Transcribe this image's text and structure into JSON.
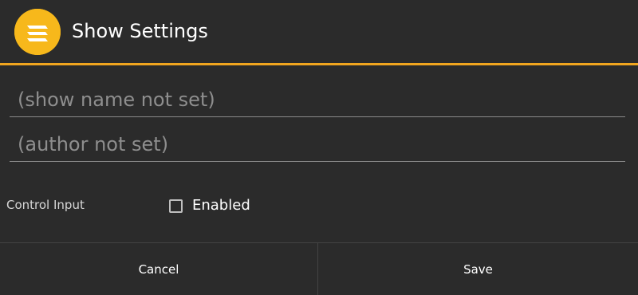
{
  "dialog": {
    "title": "Show Settings",
    "icon": "stacked-lines-logo-icon"
  },
  "fields": {
    "show_name_placeholder": "(show name not set)",
    "author_placeholder": "(author not set)"
  },
  "control_input": {
    "label": "Control Input",
    "checkbox_label": "Enabled",
    "checked": false
  },
  "buttons": {
    "cancel": "Cancel",
    "save": "Save"
  },
  "colors": {
    "background": "#2b2b2b",
    "accent": "#f0a51f",
    "icon_background": "#f7b81b",
    "text_primary": "#ffffff",
    "text_secondary": "#8e8e8e"
  }
}
